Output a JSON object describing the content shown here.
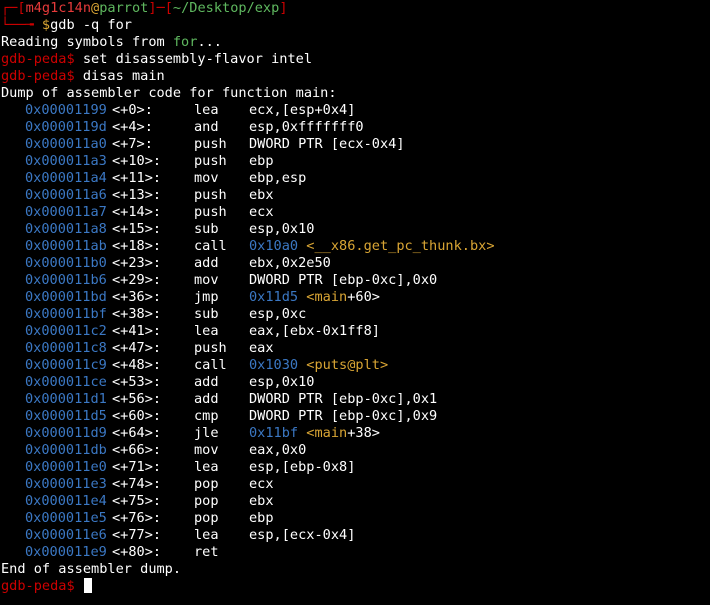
{
  "prompt": {
    "top_left": "┌─[",
    "user": "m4g1c14n",
    "at": "@",
    "host": "parrot",
    "mid": "]─[",
    "path": "~/Desktop/exp",
    "close": "]",
    "bottom": "└──╼ ",
    "dollar": "$",
    "command": "gdb -q for"
  },
  "reading": {
    "prefix": "Reading symbols from ",
    "file": "for",
    "suffix": "..."
  },
  "peda_prompt": "gdb-peda$",
  "cmd_flavor": " set disassembly-flavor intel",
  "cmd_disas": " disas main",
  "dump_header": "Dump of assembler code for function main:",
  "instructions": [
    {
      "addr": "0x00001199",
      "off": "<+0>:",
      "mn": "lea",
      "op": "ecx,[esp+0x4]"
    },
    {
      "addr": "0x0000119d",
      "off": "<+4>:",
      "mn": "and",
      "op": "esp,0xfffffff0"
    },
    {
      "addr": "0x000011a0",
      "off": "<+7>:",
      "mn": "push",
      "op": "DWORD PTR [ecx-0x4]"
    },
    {
      "addr": "0x000011a3",
      "off": "<+10>:",
      "mn": "push",
      "op": "ebp"
    },
    {
      "addr": "0x000011a4",
      "off": "<+11>:",
      "mn": "mov",
      "op": "ebp,esp"
    },
    {
      "addr": "0x000011a6",
      "off": "<+13>:",
      "mn": "push",
      "op": "ebx"
    },
    {
      "addr": "0x000011a7",
      "off": "<+14>:",
      "mn": "push",
      "op": "ecx"
    },
    {
      "addr": "0x000011a8",
      "off": "<+15>:",
      "mn": "sub",
      "op": "esp,0x10"
    },
    {
      "addr": "0x000011ab",
      "off": "<+18>:",
      "mn": "call",
      "op_addr": "0x10a0",
      "op_sym": " <__x86.get_pc_thunk.bx>"
    },
    {
      "addr": "0x000011b0",
      "off": "<+23>:",
      "mn": "add",
      "op": "ebx,0x2e50"
    },
    {
      "addr": "0x000011b6",
      "off": "<+29>:",
      "mn": "mov",
      "op": "DWORD PTR [ebp-0xc],0x0"
    },
    {
      "addr": "0x000011bd",
      "off": "<+36>:",
      "mn": "jmp",
      "op_addr": "0x11d5",
      "op_sym": " <main",
      "op_tail": "+60>"
    },
    {
      "addr": "0x000011bf",
      "off": "<+38>:",
      "mn": "sub",
      "op": "esp,0xc"
    },
    {
      "addr": "0x000011c2",
      "off": "<+41>:",
      "mn": "lea",
      "op": "eax,[ebx-0x1ff8]"
    },
    {
      "addr": "0x000011c8",
      "off": "<+47>:",
      "mn": "push",
      "op": "eax"
    },
    {
      "addr": "0x000011c9",
      "off": "<+48>:",
      "mn": "call",
      "op_addr": "0x1030",
      "op_sym": " <puts@plt>"
    },
    {
      "addr": "0x000011ce",
      "off": "<+53>:",
      "mn": "add",
      "op": "esp,0x10"
    },
    {
      "addr": "0x000011d1",
      "off": "<+56>:",
      "mn": "add",
      "op": "DWORD PTR [ebp-0xc],0x1"
    },
    {
      "addr": "0x000011d5",
      "off": "<+60>:",
      "mn": "cmp",
      "op": "DWORD PTR [ebp-0xc],0x9"
    },
    {
      "addr": "0x000011d9",
      "off": "<+64>:",
      "mn": "jle",
      "op_addr": "0x11bf",
      "op_sym": " <main",
      "op_tail": "+38>"
    },
    {
      "addr": "0x000011db",
      "off": "<+66>:",
      "mn": "mov",
      "op": "eax,0x0"
    },
    {
      "addr": "0x000011e0",
      "off": "<+71>:",
      "mn": "lea",
      "op": "esp,[ebp-0x8]"
    },
    {
      "addr": "0x000011e3",
      "off": "<+74>:",
      "mn": "pop",
      "op": "ecx"
    },
    {
      "addr": "0x000011e4",
      "off": "<+75>:",
      "mn": "pop",
      "op": "ebx"
    },
    {
      "addr": "0x000011e5",
      "off": "<+76>:",
      "mn": "pop",
      "op": "ebp"
    },
    {
      "addr": "0x000011e6",
      "off": "<+77>:",
      "mn": "lea",
      "op": "esp,[ecx-0x4]"
    },
    {
      "addr": "0x000011e9",
      "off": "<+80>:",
      "mn": "ret",
      "op": ""
    }
  ],
  "dump_footer": "End of assembler dump.",
  "colors": {
    "background": "#000000",
    "prompt_red": "#cc0000",
    "path_green": "#5fb85f",
    "address_blue": "#3b78c4",
    "symbol_yellow": "#d9a534",
    "text_white": "#ffffff"
  }
}
